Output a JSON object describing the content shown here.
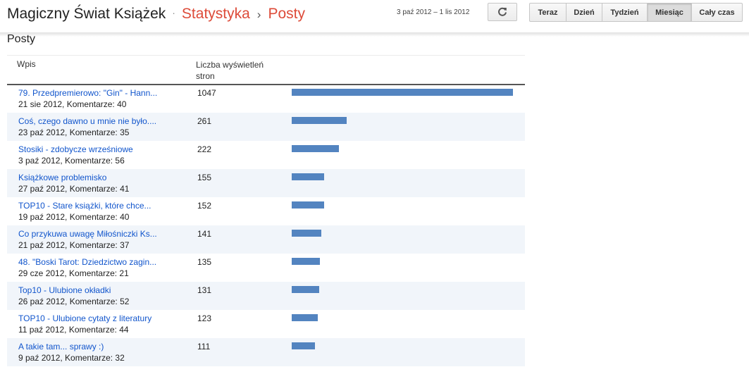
{
  "header": {
    "app_title": "Magiczny Świat Książek",
    "separator_dot": "·",
    "crumb_stats": "Statystyka",
    "crumb_sep": "›",
    "crumb_posts": "Posty",
    "date_range": "3 paź 2012 – 1 lis 2012",
    "refresh_icon": "refresh-icon",
    "periods": [
      {
        "label": "Teraz",
        "active": false
      },
      {
        "label": "Dzień",
        "active": false
      },
      {
        "label": "Tydzień",
        "active": false
      },
      {
        "label": "Miesiąc",
        "active": true
      },
      {
        "label": "Cały czas",
        "active": false
      }
    ]
  },
  "section": {
    "title": "Posty"
  },
  "table": {
    "col_post": "Wpis",
    "col_views": "Liczba wyświetleń stron",
    "bar_color": "#5384c0",
    "max_views": 1047,
    "rows": [
      {
        "title": "79. Przedpremierowo: \"Gin\" - Hann...",
        "meta": "21 sie 2012, Komentarze: 40",
        "views": 1047
      },
      {
        "title": "Coś, czego dawno u mnie nie było....",
        "meta": "23 paź 2012, Komentarze: 35",
        "views": 261
      },
      {
        "title": "Stosiki - zdobycze wrześniowe",
        "meta": "3 paź 2012, Komentarze: 56",
        "views": 222
      },
      {
        "title": "Książkowe problemisko",
        "meta": "27 paź 2012, Komentarze: 41",
        "views": 155
      },
      {
        "title": "TOP10 - Stare książki, które chce...",
        "meta": "19 paź 2012, Komentarze: 40",
        "views": 152
      },
      {
        "title": "Co przykuwa uwagę Miłośniczki Ks...",
        "meta": "21 paź 2012, Komentarze: 37",
        "views": 141
      },
      {
        "title": "48. \"Boski Tarot: Dziedzictwo zagin...",
        "meta": "29 cze 2012, Komentarze: 21",
        "views": 135
      },
      {
        "title": "Top10 - Ulubione okładki",
        "meta": "26 paź 2012, Komentarze: 52",
        "views": 131
      },
      {
        "title": "TOP10 - Ulubione cytaty z literatury",
        "meta": "11 paź 2012, Komentarze: 44",
        "views": 123
      },
      {
        "title": "A takie tam... sprawy :)",
        "meta": "9 paź 2012, Komentarze: 32",
        "views": 111
      }
    ]
  }
}
